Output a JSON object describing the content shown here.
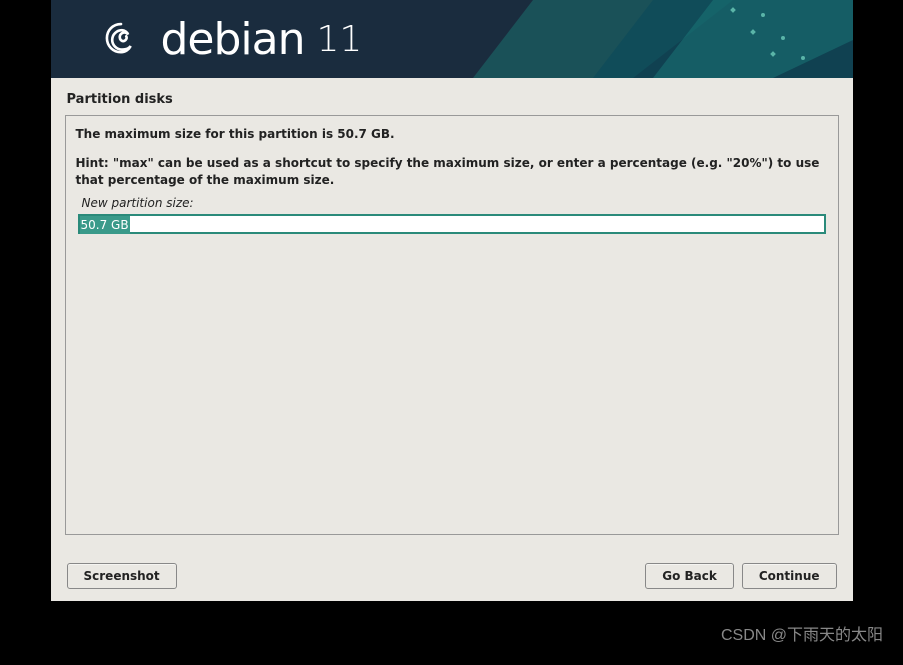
{
  "header": {
    "brand": "debian",
    "version": "11"
  },
  "page_title": "Partition disks",
  "panel": {
    "max_size_text": "The maximum size for this partition is 50.7 GB.",
    "hint_text": "Hint: \"max\" can be used as a shortcut to specify the maximum size, or enter a percentage (e.g. \"20%\") to use that percentage of the maximum size.",
    "field_label": "New partition size:",
    "input_value": "50.7 GB"
  },
  "buttons": {
    "screenshot": "Screenshot",
    "go_back": "Go Back",
    "continue": "Continue"
  },
  "watermark": "CSDN @下雨天的太阳"
}
